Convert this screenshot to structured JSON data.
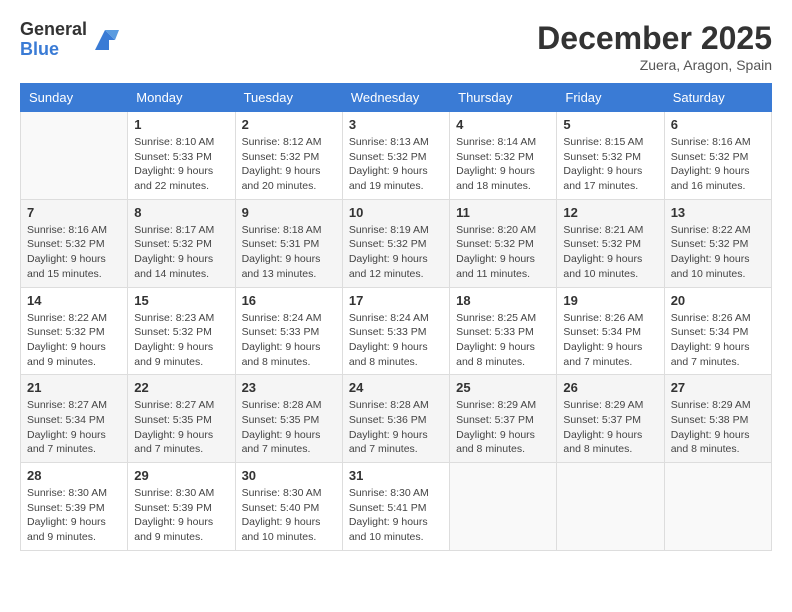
{
  "logo": {
    "general": "General",
    "blue": "Blue"
  },
  "title": "December 2025",
  "location": "Zuera, Aragon, Spain",
  "days_of_week": [
    "Sunday",
    "Monday",
    "Tuesday",
    "Wednesday",
    "Thursday",
    "Friday",
    "Saturday"
  ],
  "weeks": [
    [
      {
        "day": "",
        "sunrise": "",
        "sunset": "",
        "daylight": ""
      },
      {
        "day": "1",
        "sunrise": "Sunrise: 8:10 AM",
        "sunset": "Sunset: 5:33 PM",
        "daylight": "Daylight: 9 hours and 22 minutes."
      },
      {
        "day": "2",
        "sunrise": "Sunrise: 8:12 AM",
        "sunset": "Sunset: 5:32 PM",
        "daylight": "Daylight: 9 hours and 20 minutes."
      },
      {
        "day": "3",
        "sunrise": "Sunrise: 8:13 AM",
        "sunset": "Sunset: 5:32 PM",
        "daylight": "Daylight: 9 hours and 19 minutes."
      },
      {
        "day": "4",
        "sunrise": "Sunrise: 8:14 AM",
        "sunset": "Sunset: 5:32 PM",
        "daylight": "Daylight: 9 hours and 18 minutes."
      },
      {
        "day": "5",
        "sunrise": "Sunrise: 8:15 AM",
        "sunset": "Sunset: 5:32 PM",
        "daylight": "Daylight: 9 hours and 17 minutes."
      },
      {
        "day": "6",
        "sunrise": "Sunrise: 8:16 AM",
        "sunset": "Sunset: 5:32 PM",
        "daylight": "Daylight: 9 hours and 16 minutes."
      }
    ],
    [
      {
        "day": "7",
        "sunrise": "Sunrise: 8:16 AM",
        "sunset": "Sunset: 5:32 PM",
        "daylight": "Daylight: 9 hours and 15 minutes."
      },
      {
        "day": "8",
        "sunrise": "Sunrise: 8:17 AM",
        "sunset": "Sunset: 5:32 PM",
        "daylight": "Daylight: 9 hours and 14 minutes."
      },
      {
        "day": "9",
        "sunrise": "Sunrise: 8:18 AM",
        "sunset": "Sunset: 5:31 PM",
        "daylight": "Daylight: 9 hours and 13 minutes."
      },
      {
        "day": "10",
        "sunrise": "Sunrise: 8:19 AM",
        "sunset": "Sunset: 5:32 PM",
        "daylight": "Daylight: 9 hours and 12 minutes."
      },
      {
        "day": "11",
        "sunrise": "Sunrise: 8:20 AM",
        "sunset": "Sunset: 5:32 PM",
        "daylight": "Daylight: 9 hours and 11 minutes."
      },
      {
        "day": "12",
        "sunrise": "Sunrise: 8:21 AM",
        "sunset": "Sunset: 5:32 PM",
        "daylight": "Daylight: 9 hours and 10 minutes."
      },
      {
        "day": "13",
        "sunrise": "Sunrise: 8:22 AM",
        "sunset": "Sunset: 5:32 PM",
        "daylight": "Daylight: 9 hours and 10 minutes."
      }
    ],
    [
      {
        "day": "14",
        "sunrise": "Sunrise: 8:22 AM",
        "sunset": "Sunset: 5:32 PM",
        "daylight": "Daylight: 9 hours and 9 minutes."
      },
      {
        "day": "15",
        "sunrise": "Sunrise: 8:23 AM",
        "sunset": "Sunset: 5:32 PM",
        "daylight": "Daylight: 9 hours and 9 minutes."
      },
      {
        "day": "16",
        "sunrise": "Sunrise: 8:24 AM",
        "sunset": "Sunset: 5:33 PM",
        "daylight": "Daylight: 9 hours and 8 minutes."
      },
      {
        "day": "17",
        "sunrise": "Sunrise: 8:24 AM",
        "sunset": "Sunset: 5:33 PM",
        "daylight": "Daylight: 9 hours and 8 minutes."
      },
      {
        "day": "18",
        "sunrise": "Sunrise: 8:25 AM",
        "sunset": "Sunset: 5:33 PM",
        "daylight": "Daylight: 9 hours and 8 minutes."
      },
      {
        "day": "19",
        "sunrise": "Sunrise: 8:26 AM",
        "sunset": "Sunset: 5:34 PM",
        "daylight": "Daylight: 9 hours and 7 minutes."
      },
      {
        "day": "20",
        "sunrise": "Sunrise: 8:26 AM",
        "sunset": "Sunset: 5:34 PM",
        "daylight": "Daylight: 9 hours and 7 minutes."
      }
    ],
    [
      {
        "day": "21",
        "sunrise": "Sunrise: 8:27 AM",
        "sunset": "Sunset: 5:34 PM",
        "daylight": "Daylight: 9 hours and 7 minutes."
      },
      {
        "day": "22",
        "sunrise": "Sunrise: 8:27 AM",
        "sunset": "Sunset: 5:35 PM",
        "daylight": "Daylight: 9 hours and 7 minutes."
      },
      {
        "day": "23",
        "sunrise": "Sunrise: 8:28 AM",
        "sunset": "Sunset: 5:35 PM",
        "daylight": "Daylight: 9 hours and 7 minutes."
      },
      {
        "day": "24",
        "sunrise": "Sunrise: 8:28 AM",
        "sunset": "Sunset: 5:36 PM",
        "daylight": "Daylight: 9 hours and 7 minutes."
      },
      {
        "day": "25",
        "sunrise": "Sunrise: 8:29 AM",
        "sunset": "Sunset: 5:37 PM",
        "daylight": "Daylight: 9 hours and 8 minutes."
      },
      {
        "day": "26",
        "sunrise": "Sunrise: 8:29 AM",
        "sunset": "Sunset: 5:37 PM",
        "daylight": "Daylight: 9 hours and 8 minutes."
      },
      {
        "day": "27",
        "sunrise": "Sunrise: 8:29 AM",
        "sunset": "Sunset: 5:38 PM",
        "daylight": "Daylight: 9 hours and 8 minutes."
      }
    ],
    [
      {
        "day": "28",
        "sunrise": "Sunrise: 8:30 AM",
        "sunset": "Sunset: 5:39 PM",
        "daylight": "Daylight: 9 hours and 9 minutes."
      },
      {
        "day": "29",
        "sunrise": "Sunrise: 8:30 AM",
        "sunset": "Sunset: 5:39 PM",
        "daylight": "Daylight: 9 hours and 9 minutes."
      },
      {
        "day": "30",
        "sunrise": "Sunrise: 8:30 AM",
        "sunset": "Sunset: 5:40 PM",
        "daylight": "Daylight: 9 hours and 10 minutes."
      },
      {
        "day": "31",
        "sunrise": "Sunrise: 8:30 AM",
        "sunset": "Sunset: 5:41 PM",
        "daylight": "Daylight: 9 hours and 10 minutes."
      },
      {
        "day": "",
        "sunrise": "",
        "sunset": "",
        "daylight": ""
      },
      {
        "day": "",
        "sunrise": "",
        "sunset": "",
        "daylight": ""
      },
      {
        "day": "",
        "sunrise": "",
        "sunset": "",
        "daylight": ""
      }
    ]
  ]
}
